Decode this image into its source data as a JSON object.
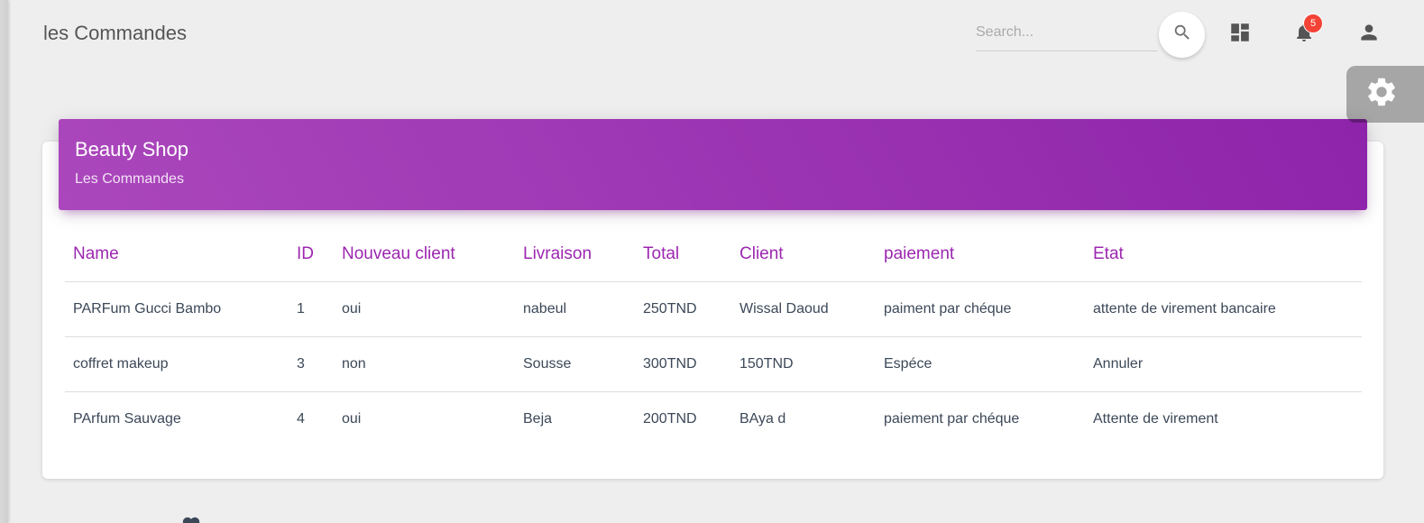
{
  "header": {
    "title": "les Commandes",
    "search": {
      "placeholder": "Search...",
      "value": ""
    },
    "notifications": {
      "count": "5"
    },
    "icons": [
      "search-icon",
      "dashboard-icon",
      "notifications-icon",
      "person-icon",
      "gear-icon"
    ]
  },
  "card": {
    "title": "Beauty Shop",
    "subtitle": "Les Commandes"
  },
  "table": {
    "columns": [
      "Name",
      "ID",
      "Nouveau client",
      "Livraison",
      "Total",
      "Client",
      "paiement",
      "Etat"
    ],
    "rows": [
      {
        "name": "PARFum Gucci Bambo",
        "id": "1",
        "nouveau_client": "oui",
        "livraison": "nabeul",
        "total": "250TND",
        "client": "Wissal Daoud",
        "paiement": "paiment par chéque",
        "etat": "attente de virement bancaire"
      },
      {
        "name": "coffret makeup",
        "id": "3",
        "nouveau_client": "non",
        "livraison": "Sousse",
        "total": "300TND",
        "client": "150TND",
        "paiement": "Espéce",
        "etat": "Annuler"
      },
      {
        "name": "PArfum Sauvage",
        "id": "4",
        "nouveau_client": "oui",
        "livraison": "Beja",
        "total": "200TND",
        "client": "BAya d",
        "paiement": "paiement par chéque",
        "etat": "Attente de virement"
      }
    ]
  },
  "colors": {
    "accent": "#9c27b0",
    "header_gradient_start": "#ab47bc",
    "header_gradient_end": "#8e24aa",
    "badge": "#f44336",
    "background": "#eeeeee"
  }
}
